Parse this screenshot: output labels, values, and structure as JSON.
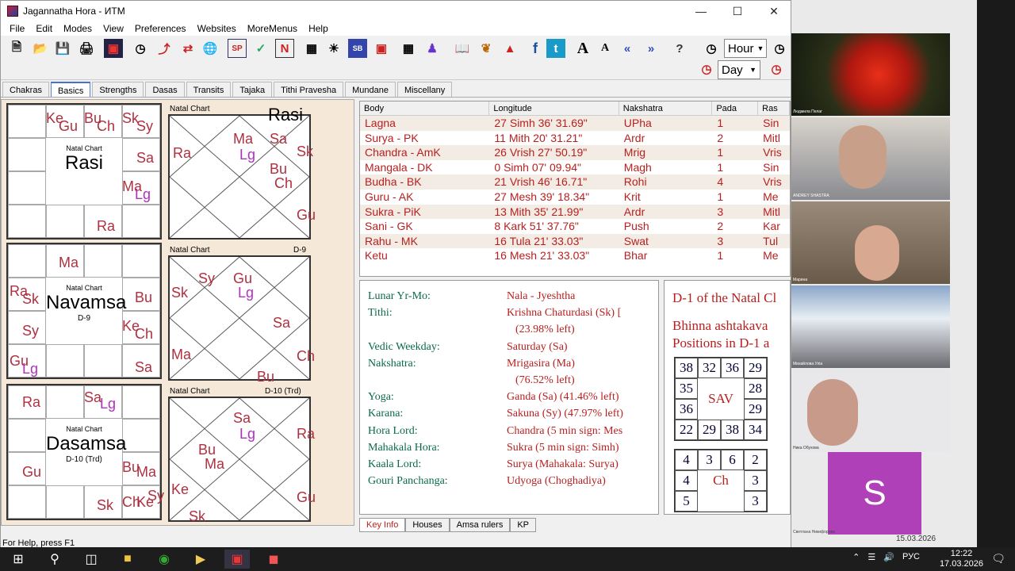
{
  "window": {
    "title": "Jagannatha Hora - ИТМ"
  },
  "menu": [
    "File",
    "Edit",
    "Modes",
    "View",
    "Preferences",
    "Websites",
    "MoreMenus",
    "Help"
  ],
  "toolbar": {
    "hour_label": "Hour",
    "day_label": "Day"
  },
  "tabs": [
    "Chakras",
    "Basics",
    "Strengths",
    "Dasas",
    "Transits",
    "Tajaka",
    "Tithi Pravesha",
    "Mundane",
    "Miscellany"
  ],
  "charts": {
    "rasi": {
      "caption": "Natal Chart",
      "name": "Rasi",
      "south_planets": [
        "Ke",
        "Gu",
        "Bu",
        "Ch",
        "Sk",
        "Sy",
        "Sa",
        "Ma",
        "Lg",
        "Ra"
      ]
    },
    "navamsa": {
      "caption": "Natal Chart",
      "name": "Navamsa",
      "sub": "D-9",
      "planets": [
        "Ma",
        "Ra",
        "Sk",
        "Bu",
        "Sy",
        "Ke",
        "Ch",
        "Gu",
        "Lg",
        "Sa"
      ]
    },
    "dasamsa": {
      "caption": "Natal Chart",
      "name": "Dasamsa",
      "sub": "D-10 (Trd)",
      "planets": [
        "Ra",
        "Sa",
        "Lg",
        "Bu",
        "Ma",
        "Gu",
        "Sk",
        "Ch",
        "Ke",
        "Sy"
      ]
    },
    "north1": {
      "caption": "Natal Chart",
      "name": "Rasi"
    },
    "north2": {
      "caption": "Natal Chart",
      "name": "D-9"
    },
    "north3": {
      "caption": "Natal Chart",
      "name": "D-10 (Trd)"
    }
  },
  "table": {
    "headers": [
      "Body",
      "Longitude",
      "Nakshatra",
      "Pada",
      "Ras"
    ],
    "rows": [
      [
        "Lagna",
        "27 Simh 36' 31.69\"",
        "UPha",
        "1",
        "Sin"
      ],
      [
        "Surya - PK",
        "11 Mith 20' 31.21\"",
        "Ardr",
        "2",
        "Mitl"
      ],
      [
        "Chandra - AmK",
        "26 Vrish 27' 50.19\"",
        "Mrig",
        "1",
        "Vris"
      ],
      [
        "Mangala - DK",
        "0 Simh 07' 09.94\"",
        "Magh",
        "1",
        "Sin"
      ],
      [
        "Budha - BK",
        "21 Vrish 46' 16.71\"",
        "Rohi",
        "4",
        "Vris"
      ],
      [
        "Guru - AK",
        "27 Mesh 39' 18.34\"",
        "Krit",
        "1",
        "Me"
      ],
      [
        "Sukra - PiK",
        "13 Mith 35' 21.99\"",
        "Ardr",
        "3",
        "Mitl"
      ],
      [
        "Sani - GK",
        "8 Kark 51' 37.76\"",
        "Push",
        "2",
        "Kar"
      ],
      [
        "Rahu - MK",
        "16 Tula 21' 33.03\"",
        "Swat",
        "3",
        "Tul"
      ],
      [
        "Ketu",
        "16 Mesh 21' 33.03\"",
        "Bhar",
        "1",
        "Me"
      ]
    ]
  },
  "keyinfo": [
    {
      "k": "Lunar Yr-Mo:",
      "v": "Nala - Jyeshtha"
    },
    {
      "k": "Tithi:",
      "v": "Krishna Chaturdasi (Sk) ["
    },
    {
      "k": "",
      "v": "(23.98% left)"
    },
    {
      "k": "Vedic Weekday:",
      "v": "Saturday (Sa)"
    },
    {
      "k": "Nakshatra:",
      "v": "Mrigasira (Ma)"
    },
    {
      "k": "",
      "v": "(76.52% left)"
    },
    {
      "k": "Yoga:",
      "v": "Ganda (Sa) (41.46% left)"
    },
    {
      "k": "Karana:",
      "v": "Sakuna (Sy) (47.97% left)"
    },
    {
      "k": "Hora Lord:",
      "v": "Chandra (5 min sign: Mes"
    },
    {
      "k": "Mahakala Hora:",
      "v": "Sukra (5 min sign: Simh)"
    },
    {
      "k": "Kaala Lord:",
      "v": "Surya (Mahakala: Surya)"
    },
    {
      "k": "Gouri Panchanga:",
      "v": "Udyoga (Choghadiya)"
    }
  ],
  "bhinna": {
    "title1": "D-1 of the Natal Cl",
    "title2a": "Bhinna ashtakava",
    "title2b": "Positions in D-1 a",
    "sav_label": "SAV",
    "sav": [
      "38",
      "32",
      "36",
      "29",
      "35",
      "28",
      "36",
      "29",
      "22",
      "29",
      "38",
      "34"
    ],
    "ch_label": "Ch",
    "ch": [
      "4",
      "3",
      "6",
      "2",
      "4",
      "3",
      "5",
      "3"
    ]
  },
  "bottom_tabs": [
    "Key Info",
    "Houses",
    "Amsa rulers",
    "KP"
  ],
  "status": "For Help, press F1",
  "video": {
    "names": [
      "Людмила Пелаг",
      "ANDREY SHASTRA",
      "Марина",
      "Михайлова Уліа",
      "Ника Обухова",
      "Светлана Никифорова"
    ],
    "avatar_letter": "S",
    "date_overlay": "15.03.2026"
  },
  "taskbar": {
    "time": "12:22",
    "date": "17.03.2026",
    "lang": "РУС"
  }
}
